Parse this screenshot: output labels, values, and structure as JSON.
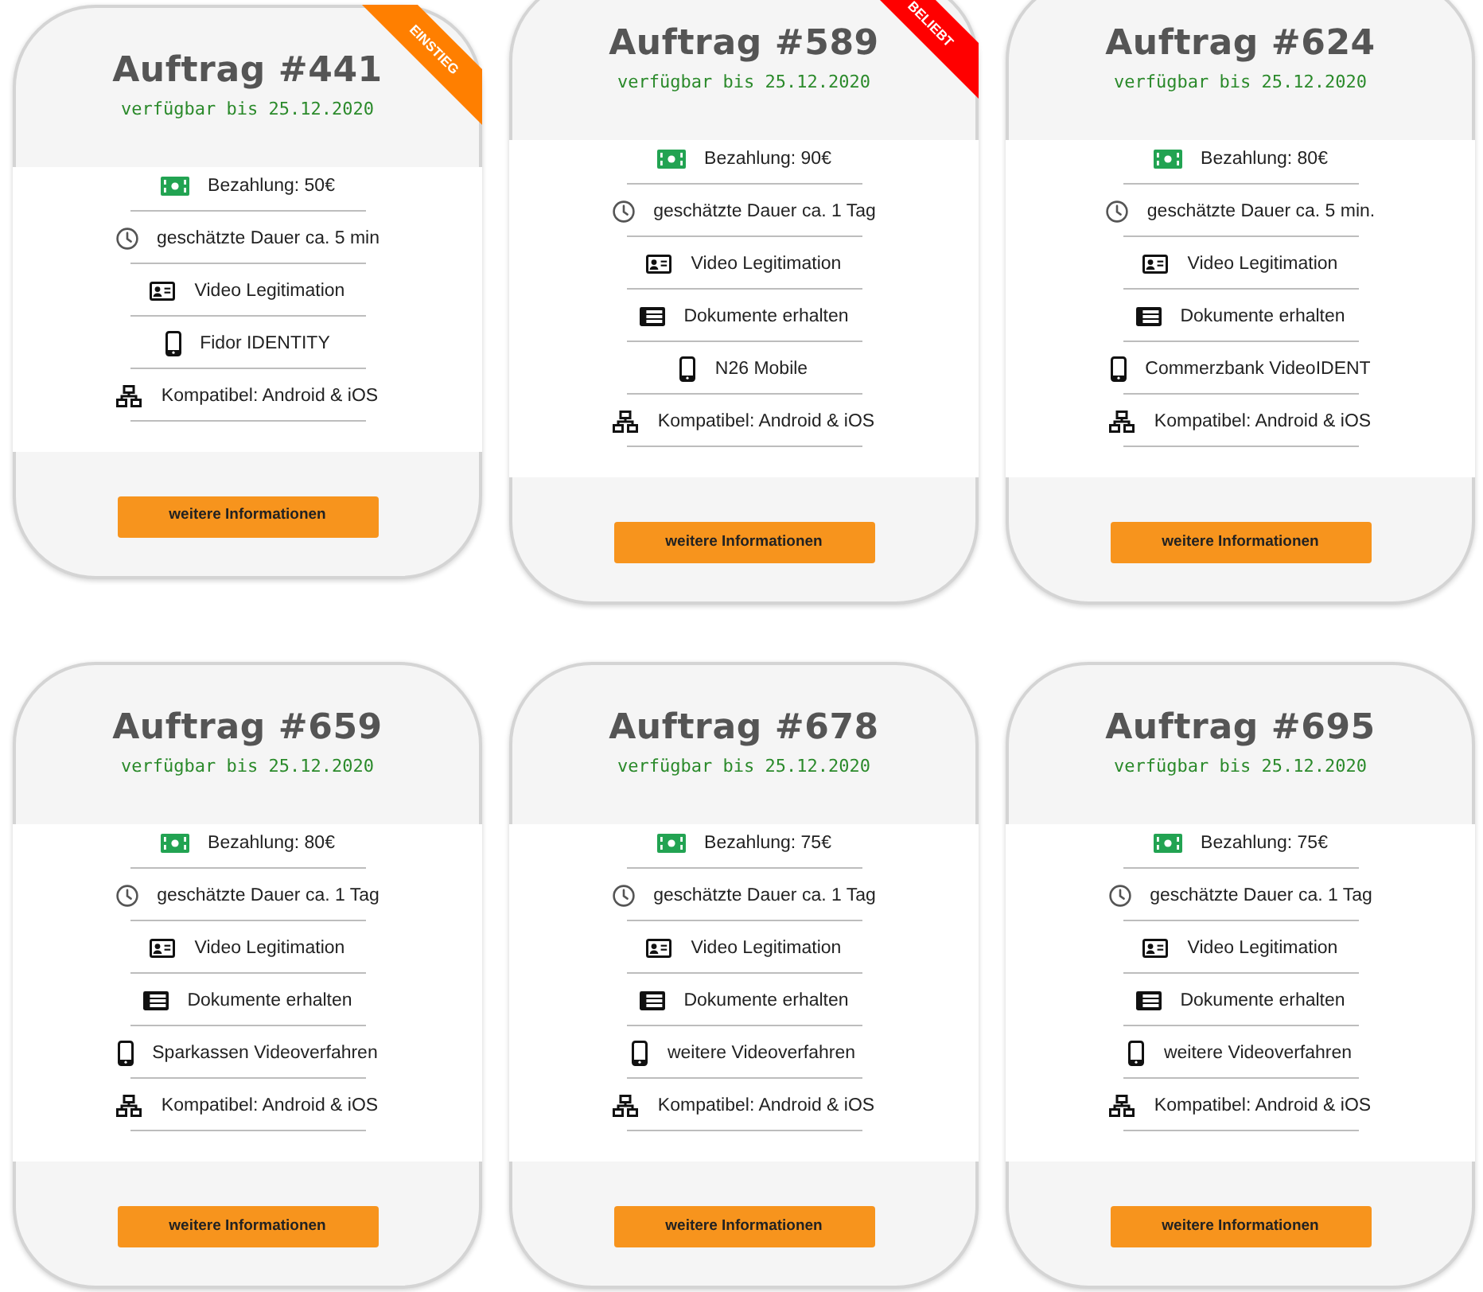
{
  "cards": [
    {
      "title": "Auftrag #441",
      "availability": "verfügbar bis 25.12.2020",
      "ribbon": {
        "label": "EINSTIEG",
        "color": "#ff7f00"
      },
      "features": [
        {
          "kind": "payment",
          "text": "Bezahlung: 50€"
        },
        {
          "kind": "duration",
          "text": "geschätzte Dauer ca. 5 min"
        },
        {
          "kind": "video",
          "text": "Video Legitimation"
        },
        {
          "kind": "app",
          "text": "Fidor IDENTITY"
        },
        {
          "kind": "compatibility",
          "text": "Kompatibel: Android & iOS"
        }
      ],
      "button": "weitere Informationen"
    },
    {
      "title": "Auftrag #589",
      "availability": "verfügbar bis 25.12.2020",
      "ribbon": {
        "label": "BELIEBT",
        "color": "#ff0000"
      },
      "features": [
        {
          "kind": "payment",
          "text": "Bezahlung: 90€"
        },
        {
          "kind": "duration",
          "text": "geschätzte Dauer ca. 1 Tag"
        },
        {
          "kind": "video",
          "text": "Video Legitimation"
        },
        {
          "kind": "documents",
          "text": "Dokumente erhalten"
        },
        {
          "kind": "app",
          "text": "N26 Mobile"
        },
        {
          "kind": "compatibility",
          "text": "Kompatibel: Android & iOS"
        }
      ],
      "button": "weitere Informationen"
    },
    {
      "title": "Auftrag #624",
      "availability": "verfügbar bis 25.12.2020",
      "features": [
        {
          "kind": "payment",
          "text": "Bezahlung: 80€"
        },
        {
          "kind": "duration",
          "text": "geschätzte Dauer ca. 5 min."
        },
        {
          "kind": "video",
          "text": "Video Legitimation"
        },
        {
          "kind": "documents",
          "text": "Dokumente erhalten"
        },
        {
          "kind": "app",
          "text": "Commerzbank VideoIDENT"
        },
        {
          "kind": "compatibility",
          "text": "Kompatibel: Android & iOS"
        }
      ],
      "button": "weitere Informationen"
    },
    {
      "title": "Auftrag #659",
      "availability": "verfügbar bis 25.12.2020",
      "features": [
        {
          "kind": "payment",
          "text": "Bezahlung: 80€"
        },
        {
          "kind": "duration",
          "text": "geschätzte Dauer ca. 1 Tag"
        },
        {
          "kind": "video",
          "text": "Video Legitimation"
        },
        {
          "kind": "documents",
          "text": "Dokumente erhalten"
        },
        {
          "kind": "app",
          "text": "Sparkassen Videoverfahren"
        },
        {
          "kind": "compatibility",
          "text": "Kompatibel: Android & iOS"
        }
      ],
      "button": "weitere Informationen"
    },
    {
      "title": "Auftrag #678",
      "availability": "verfügbar bis 25.12.2020",
      "features": [
        {
          "kind": "payment",
          "text": "Bezahlung: 75€"
        },
        {
          "kind": "duration",
          "text": "geschätzte Dauer ca. 1 Tag"
        },
        {
          "kind": "video",
          "text": "Video Legitimation"
        },
        {
          "kind": "documents",
          "text": "Dokumente erhalten"
        },
        {
          "kind": "app",
          "text": "weitere Videoverfahren"
        },
        {
          "kind": "compatibility",
          "text": "Kompatibel: Android & iOS"
        }
      ],
      "button": "weitere Informationen"
    },
    {
      "title": "Auftrag #695",
      "availability": "verfügbar bis 25.12.2020",
      "features": [
        {
          "kind": "payment",
          "text": "Bezahlung: 75€"
        },
        {
          "kind": "duration",
          "text": "geschätzte Dauer ca. 1 Tag"
        },
        {
          "kind": "video",
          "text": "Video Legitimation"
        },
        {
          "kind": "documents",
          "text": "Dokumente erhalten"
        },
        {
          "kind": "app",
          "text": "weitere Videoverfahren"
        },
        {
          "kind": "compatibility",
          "text": "Kompatibel: Android & iOS"
        }
      ],
      "button": "weitere Informationen"
    }
  ]
}
